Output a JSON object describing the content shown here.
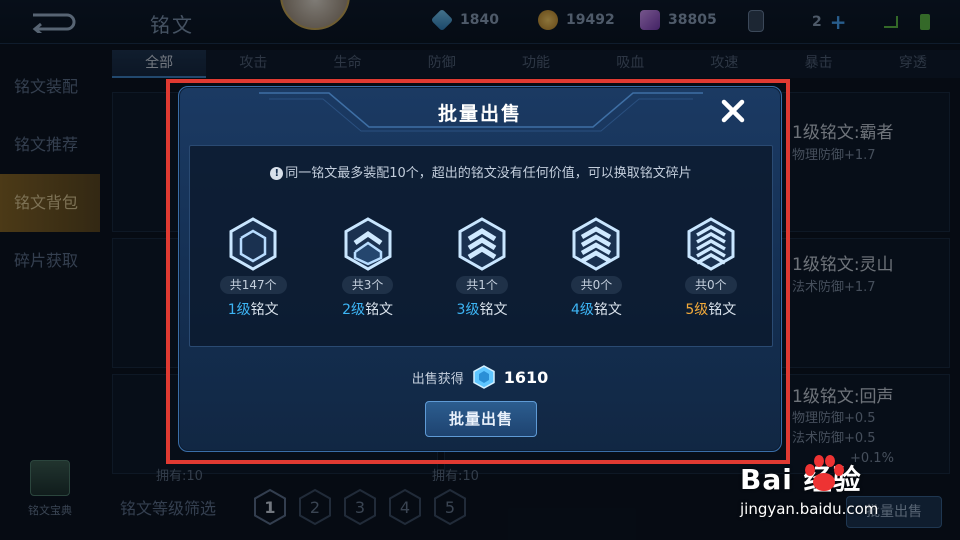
{
  "header": {
    "title": "铭文",
    "currencies": {
      "crystal": "1840",
      "gold": "19492",
      "gem": "38805",
      "cards": "2"
    }
  },
  "tabs": [
    "全部",
    "攻击",
    "生命",
    "防御",
    "功能",
    "吸血",
    "攻速",
    "暴击",
    "穿透"
  ],
  "sidebar": {
    "items": [
      "铭文装配",
      "铭文推荐",
      "铭文背包",
      "碎片获取"
    ],
    "codex": "铭文宝典"
  },
  "background": {
    "cards": [
      {
        "name": "1级铭文:霸者",
        "attrs": [
          "物理防御+1.7"
        ]
      },
      {
        "name": "1级铭文:灵山",
        "attrs": [
          "法术防御+1.7"
        ]
      },
      {
        "name": "1级铭文:回声",
        "attrs": [
          "物理防御+0.5",
          "法术防御+0.5",
          "+0.1%"
        ]
      }
    ],
    "owned": [
      "拥有:10",
      "拥有:10"
    ],
    "filter_label": "铭文等级筛选",
    "filter_levels": [
      "1",
      "2",
      "3",
      "4",
      "5"
    ],
    "sell_button": "批量出售"
  },
  "dialog": {
    "title": "批量出售",
    "notice": "同一铭文最多装配10个，超出的铭文没有任何价值，可以换取铭文碎片",
    "tiers": [
      {
        "count": "共147个",
        "level": "1级",
        "suffix": "铭文"
      },
      {
        "count": "共3个",
        "level": "2级",
        "suffix": "铭文"
      },
      {
        "count": "共1个",
        "level": "3级",
        "suffix": "铭文"
      },
      {
        "count": "共0个",
        "level": "4级",
        "suffix": "铭文"
      },
      {
        "count": "共0个",
        "level": "5级",
        "suffix": "铭文"
      }
    ],
    "earn_label": "出售获得",
    "earn_amount": "1610",
    "confirm_button": "批量出售"
  },
  "watermark": {
    "main": "Bai 经验",
    "sub": "jingyan.baidu.com"
  },
  "colors": {
    "highlight": "#e03a32",
    "tier_blue": "#3db5f5",
    "tier_gold": "#f2a93a"
  }
}
